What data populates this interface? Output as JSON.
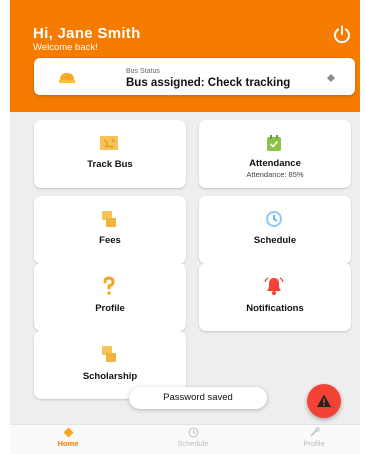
{
  "header": {
    "greeting": "Hi, Jane Smith",
    "subtitle": "Welcome back!",
    "power_icon": "power-icon",
    "color": "#f57c00"
  },
  "bus_status": {
    "label": "Bus Status",
    "value": "Bus assigned: Check tracking",
    "icon": "bus-icon",
    "chevron_icon": "chevron-icon"
  },
  "tiles": [
    {
      "label": "Track Bus",
      "icon": "map-icon"
    },
    {
      "label": "Attendance",
      "sublabel": "Attendance: 85%",
      "icon": "calendar-check-icon"
    },
    {
      "label": "Fees",
      "icon": "receipt-icon"
    },
    {
      "label": "Schedule",
      "icon": "clock-icon"
    },
    {
      "label": "Profile",
      "icon": "question-mark-icon"
    },
    {
      "label": "Notifications",
      "icon": "bell-icon"
    },
    {
      "label": "Scholarship",
      "icon": "scholarship-icon"
    }
  ],
  "toast": {
    "text": "Password saved"
  },
  "fab": {
    "icon": "warning-icon",
    "color": "#f44336"
  },
  "bottom_nav": [
    {
      "label": "Home",
      "icon": "home-icon",
      "active": true
    },
    {
      "label": "Schedule",
      "icon": "clock-icon",
      "active": false
    },
    {
      "label": "Profile",
      "icon": "settings-icon",
      "active": false
    }
  ],
  "colors": {
    "accent": "#f57c00",
    "inactive": "#bdbdbd",
    "alert": "#f44336"
  }
}
